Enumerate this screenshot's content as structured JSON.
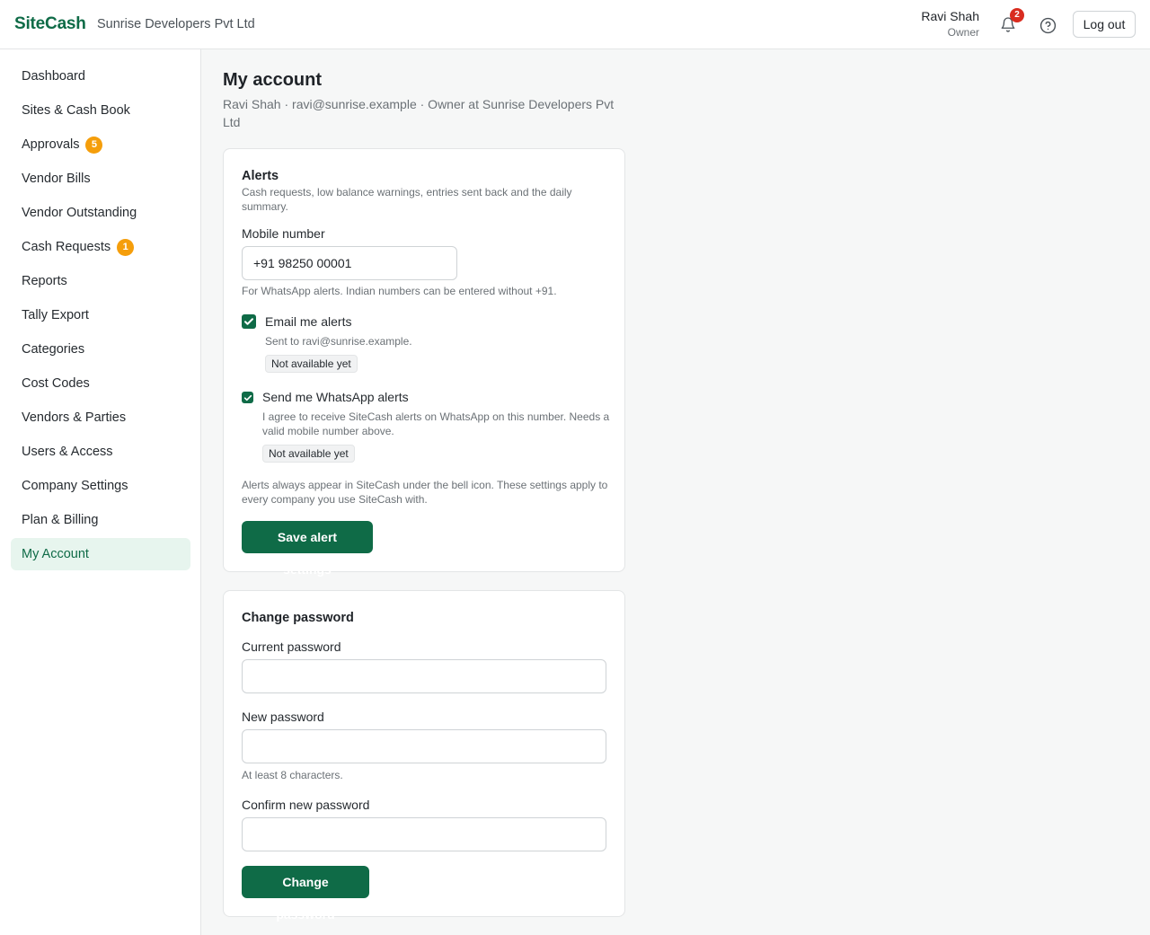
{
  "header": {
    "brand": "SiteCash",
    "company": "Sunrise Developers Pvt Ltd",
    "user_name": "Ravi Shah",
    "user_role": "Owner",
    "notification_count": "2",
    "logout_label": "Log out",
    "icons": {
      "bell": "bell-icon",
      "help": "help-circle-icon"
    }
  },
  "sidebar": {
    "items": [
      {
        "label": "Dashboard"
      },
      {
        "label": "Sites & Cash Book"
      },
      {
        "label": "Approvals",
        "badge": "5"
      },
      {
        "label": "Vendor Bills"
      },
      {
        "label": "Vendor Outstanding"
      },
      {
        "label": "Cash Requests",
        "badge": "1"
      },
      {
        "label": "Reports"
      },
      {
        "label": "Tally Export"
      },
      {
        "label": "Categories"
      },
      {
        "label": "Cost Codes"
      },
      {
        "label": "Vendors & Parties"
      },
      {
        "label": "Users & Access"
      },
      {
        "label": "Company Settings"
      },
      {
        "label": "Plan & Billing"
      },
      {
        "label": "My Account",
        "active": true
      }
    ]
  },
  "page": {
    "title": "My account",
    "subtitle": "Ravi Shah · ravi@sunrise.example · Owner at Sunrise Developers Pvt Ltd"
  },
  "alerts": {
    "title": "Alerts",
    "description": "Cash requests, low balance warnings, entries sent back and the daily summary.",
    "mobile_label": "Mobile number",
    "mobile_value": "+91 98250 00001",
    "mobile_hint": "For WhatsApp alerts. Indian numbers can be entered without +91.",
    "email_label": "Email me alerts",
    "email_checked": true,
    "email_hint": "Sent to ravi@sunrise.example.",
    "email_status": "Not available yet",
    "whatsapp_label": "Send me WhatsApp alerts",
    "whatsapp_checked": true,
    "whatsapp_hint": "I agree to receive SiteCash alerts on WhatsApp on this number. Needs a valid mobile number above.",
    "whatsapp_status": "Not available yet",
    "footer_note": "Alerts always appear in SiteCash under the bell icon. These settings apply to every company you use SiteCash with.",
    "save_label": "Save alert settings"
  },
  "password": {
    "title": "Change password",
    "current_label": "Current password",
    "current_value": "",
    "new_label": "New password",
    "new_value": "",
    "new_hint": "At least 8 characters.",
    "confirm_label": "Confirm new password",
    "confirm_value": "",
    "submit_label": "Change password"
  },
  "colors": {
    "brand": "#0f6b47",
    "active_nav_bg": "#e7f5ee",
    "nav_badge": "#f59e0b",
    "notification_badge": "#d92d20"
  }
}
